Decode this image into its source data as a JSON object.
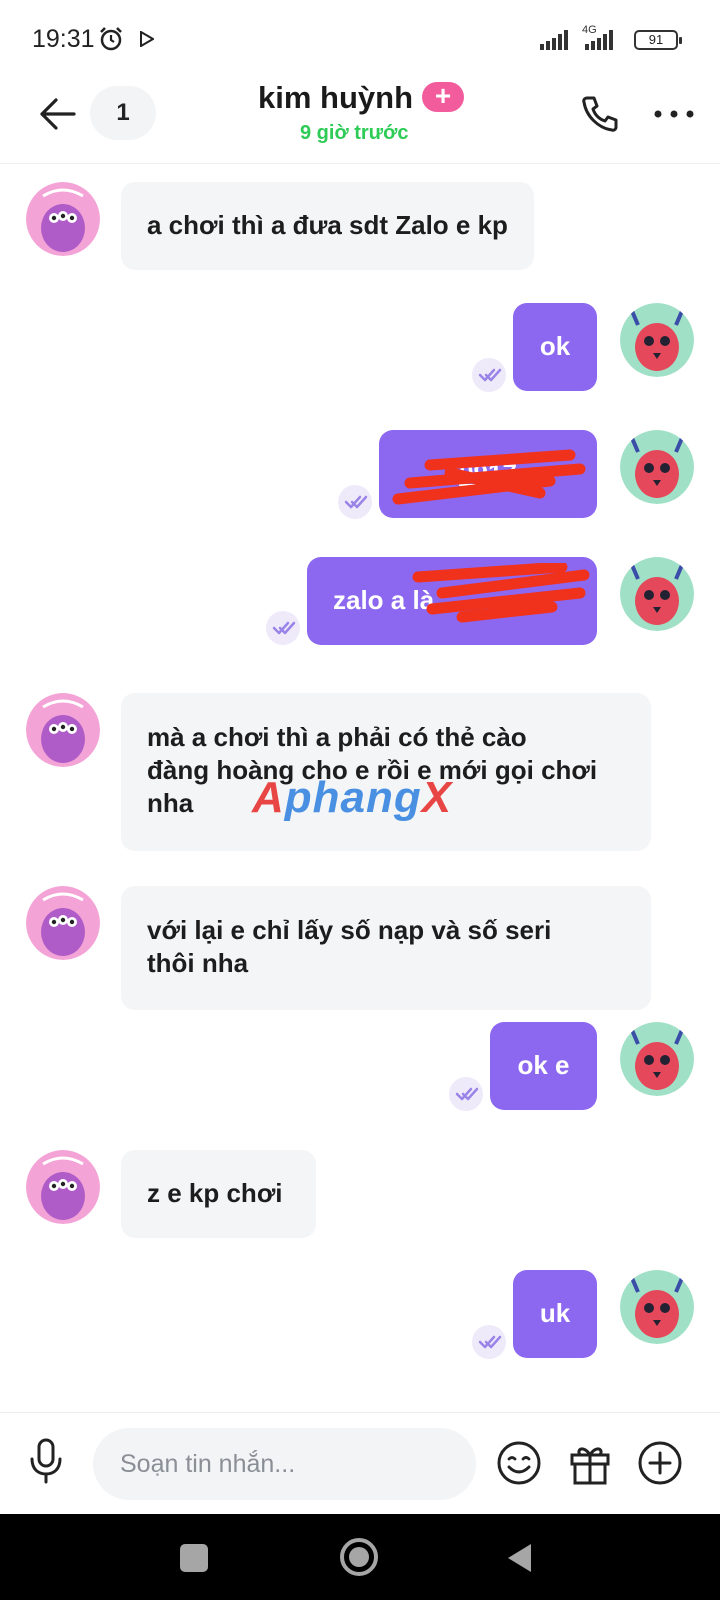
{
  "status_bar": {
    "time": "19:31",
    "network": "4G",
    "battery": "91"
  },
  "header": {
    "unread_count": "1",
    "contact_name": "kim huỳnh",
    "vip_mark": "+",
    "last_seen": "9 giờ trước"
  },
  "messages": [
    {
      "from": "them",
      "lines": [
        "a chơi thì a đưa sdt Zalo e kp"
      ]
    },
    {
      "from": "me",
      "lines": [
        "ok"
      ]
    },
    {
      "from": "me",
      "lines": [
        "0917"
      ],
      "redacted": true
    },
    {
      "from": "me",
      "lines": [
        "zalo a là"
      ],
      "redacted": true
    },
    {
      "from": "them",
      "lines": [
        "mà a chơi thì a phải có thẻ cào",
        "đàng hoàng cho e rồi e mới gọi chơi",
        "nha"
      ]
    },
    {
      "from": "them",
      "lines": [
        "với lại e chỉ lấy số nạp và số seri",
        "thôi nha"
      ]
    },
    {
      "from": "me",
      "lines": [
        "ok e"
      ]
    },
    {
      "from": "them",
      "lines": [
        "z e kp chơi"
      ]
    },
    {
      "from": "me",
      "lines": [
        "uk"
      ]
    }
  ],
  "watermark": {
    "a": "A",
    "rest": "phang",
    "x": "X"
  },
  "composer": {
    "placeholder": "Soạn tin nhắn..."
  },
  "colors": {
    "outgoing_bubble": "#8c68f0",
    "incoming_bubble": "#f4f5f7",
    "last_seen": "#2ecc56",
    "vip_badge": "#f25c9c"
  },
  "icons": [
    "back-arrow-icon",
    "phone-icon",
    "more-icon",
    "mic-icon",
    "emoji-icon",
    "gift-icon",
    "add-circle-icon",
    "seen-check-icon"
  ]
}
